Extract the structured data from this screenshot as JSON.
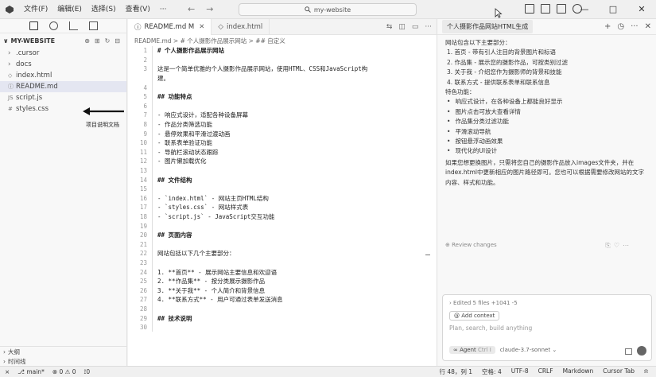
{
  "titlebar": {
    "menu": [
      "文件(F)",
      "编辑(E)",
      "选择(S)",
      "查看(V)",
      "···"
    ],
    "search": "my-website",
    "window_controls": [
      "—",
      "□",
      "✕"
    ]
  },
  "explorer": {
    "root": "MY-WEBSITE",
    "items": [
      {
        "label": ".cursor",
        "type": "folder"
      },
      {
        "label": "docs",
        "type": "folder"
      },
      {
        "label": "index.html",
        "type": "html"
      },
      {
        "label": "README.md",
        "type": "md"
      },
      {
        "label": "script.js",
        "type": "js"
      },
      {
        "label": "styles.css",
        "type": "css"
      }
    ],
    "annotation": "项目说明文档",
    "bottom": [
      "大纲",
      "时间线"
    ]
  },
  "editor": {
    "tabs": [
      {
        "label": "README.md M",
        "active": true
      },
      {
        "label": "index.html",
        "active": false
      }
    ],
    "breadcrumb": "README.md > # 个人摄影作品展示网站 > ## 自定义",
    "lines": [
      {
        "n": "1",
        "t": "# 个人摄影作品展示网站",
        "h": true
      },
      {
        "n": "2",
        "t": ""
      },
      {
        "n": "3",
        "t": "这是一个简单优雅的个人摄影作品展示网站，使用HTML、CSS和JavaScript构"
      },
      {
        "n": "",
        "t": "建。"
      },
      {
        "n": "4",
        "t": ""
      },
      {
        "n": "5",
        "t": "## 功能特点",
        "h": true
      },
      {
        "n": "6",
        "t": ""
      },
      {
        "n": "7",
        "t": "- 响应式设计，适配各种设备屏幕"
      },
      {
        "n": "8",
        "t": "- 作品分类筛选功能"
      },
      {
        "n": "9",
        "t": "- 悬停效果和平滑过渡动画"
      },
      {
        "n": "10",
        "t": "- 联系表单验证功能"
      },
      {
        "n": "11",
        "t": "- 导航栏滚动状态跟踪"
      },
      {
        "n": "12",
        "t": "- 图片懒加载优化"
      },
      {
        "n": "13",
        "t": ""
      },
      {
        "n": "14",
        "t": "## 文件结构",
        "h": true
      },
      {
        "n": "15",
        "t": ""
      },
      {
        "n": "16",
        "t": "- `index.html` - 网站主页HTML结构"
      },
      {
        "n": "17",
        "t": "- `styles.css` - 网站样式表"
      },
      {
        "n": "18",
        "t": "- `script.js` - JavaScript交互功能"
      },
      {
        "n": "19",
        "t": ""
      },
      {
        "n": "20",
        "t": "## 页面内容",
        "h": true
      },
      {
        "n": "21",
        "t": ""
      },
      {
        "n": "22",
        "t": "网站包括以下几个主要部分："
      },
      {
        "n": "23",
        "t": ""
      },
      {
        "n": "24",
        "t": "1. **首页** - 展示网站主要信息和欢迎语"
      },
      {
        "n": "25",
        "t": "2. **作品集** - 按分类展示摄影作品"
      },
      {
        "n": "26",
        "t": "3. **关于我** - 个人简介和背景信息"
      },
      {
        "n": "27",
        "t": "4. **联系方式** - 用户可通过表单发送消息"
      },
      {
        "n": "28",
        "t": ""
      },
      {
        "n": "29",
        "t": "## 技术说明",
        "h": true
      },
      {
        "n": "30",
        "t": ""
      }
    ]
  },
  "chat": {
    "tab": "个人摄影作品网站HTML生成",
    "intro": "网站包含以下主要部分：",
    "sections": [
      "1. 首页 - 带有引人注目的背景图片和标语",
      "2. 作品集 - 展示您的摄影作品，可按类别过滤",
      "3. 关于我 - 介绍您作为摄影师的背景和技能",
      "4. 联系方式 - 提供联系表单和联系信息"
    ],
    "features_title": "特色功能：",
    "features": [
      "响应式设计，在各种设备上都能良好显示",
      "图片点击可放大查看详情",
      "作品集分类过滤功能",
      "平滑滚动导航",
      "按钮悬浮动画效果",
      "现代化的UI设计"
    ],
    "note": "如果您想更换图片，只需将您自己的摄影作品放入images文件夹，并在index.html中更新相应的图片路径即可。您也可以根据需要修改网站的文字内容、样式和功能。",
    "review": "Review changes",
    "edited": "Edited 5 files +1041 -5",
    "add_context": "Add context",
    "placeholder": "Plan, search, build anything",
    "agent": "Agent",
    "agent_shortcut": "Ctrl I",
    "model": "claude-3.7-sonnet"
  },
  "status": {
    "left": [
      "⎇ main*",
      "⊗ 0 ⚠ 0",
      "⟟0"
    ],
    "right": [
      "行 48，列 1",
      "空格: 4",
      "UTF-8",
      "CRLF",
      "Markdown",
      "Cursor Tab"
    ]
  }
}
